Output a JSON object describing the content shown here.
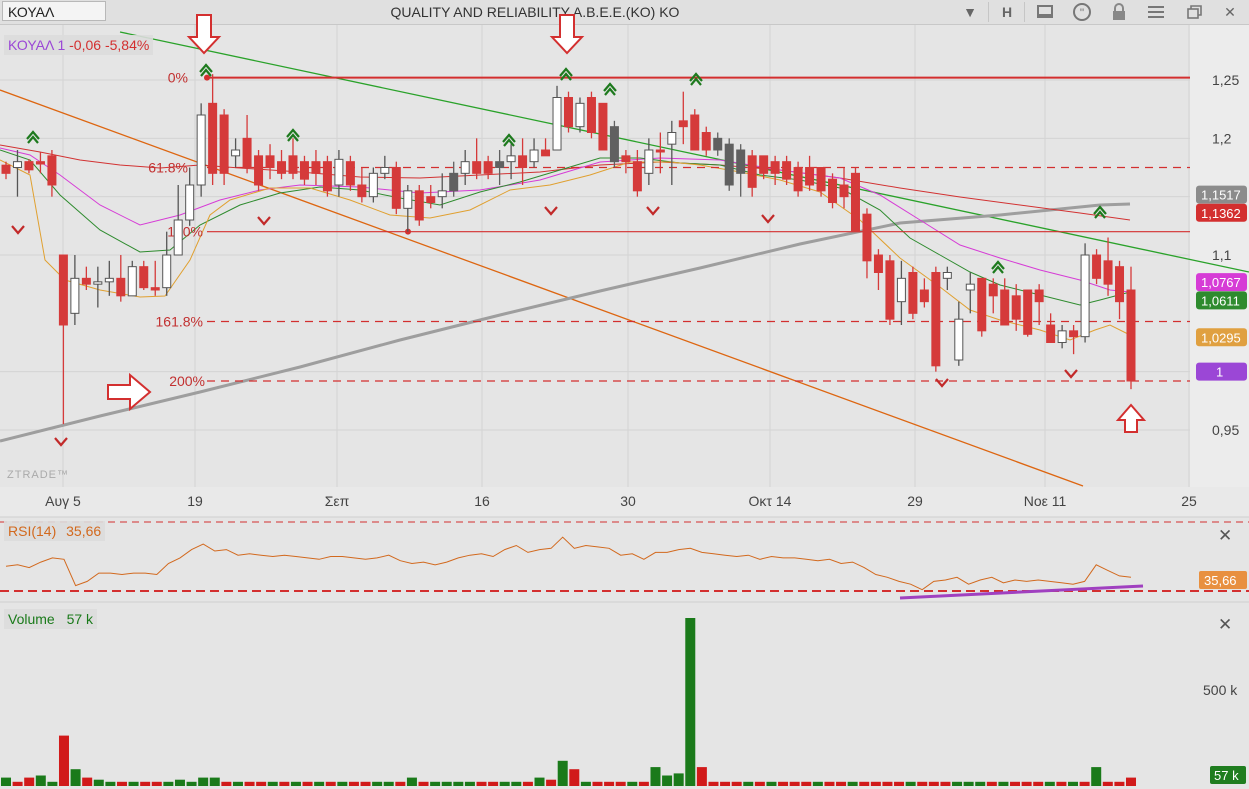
{
  "titlebar": {
    "symbol": "ΚΟΥΑΛ",
    "company": "QUALITY AND RELIABILITY A.B.E.E.(KO) KO",
    "h_label": "H"
  },
  "legend": {
    "price": {
      "name": "ΚΟΥΑΛ 1",
      "change": "-0,06",
      "pct": "-5,84%"
    },
    "rsi": {
      "name": "RSI(14)",
      "value": "35,66"
    },
    "volume": {
      "name": "Volume",
      "value": "57 k"
    }
  },
  "watermark": "ZTRADE™",
  "colors": {
    "up": "#ffffff",
    "down": "#d53a3a",
    "neutral": "#606060",
    "fib": "#d32f2f",
    "sma200": "#9a9a9a",
    "rsi": "#d2691e",
    "vol_up": "#1a7a1a",
    "vol_down": "#d11a1a"
  },
  "chart_data": [
    {
      "type": "candlestick",
      "title": "QUALITY AND RELIABILITY A.B.E.E.(KO) KO",
      "x_ticks": [
        "Αυγ 5",
        "19",
        "Σεπ",
        "16",
        "30",
        "Οκτ 14",
        "29",
        "Νοε 11",
        "25"
      ],
      "y_ticks": [
        "1,25",
        "1,2",
        "1,15",
        "1,1",
        "1",
        "0,95"
      ],
      "ylim": [
        0.91,
        1.27
      ],
      "candles": [
        [
          1.177,
          1.18,
          1.165,
          1.17
        ],
        [
          1.175,
          1.19,
          1.15,
          1.18
        ],
        [
          1.18,
          1.182,
          1.17,
          1.173
        ],
        [
          1.18,
          1.188,
          1.17,
          1.178
        ],
        [
          1.185,
          1.19,
          1.15,
          1.16
        ],
        [
          1.1,
          1.1,
          0.955,
          1.04
        ],
        [
          1.05,
          1.1,
          1.04,
          1.08
        ],
        [
          1.08,
          1.09,
          1.07,
          1.075
        ],
        [
          1.075,
          1.09,
          1.055,
          1.077
        ],
        [
          1.077,
          1.095,
          1.065,
          1.08
        ],
        [
          1.08,
          1.1,
          1.06,
          1.065
        ],
        [
          1.065,
          1.095,
          1.065,
          1.09
        ],
        [
          1.09,
          1.095,
          1.07,
          1.072
        ],
        [
          1.072,
          1.095,
          1.065,
          1.07
        ],
        [
          1.072,
          1.12,
          1.065,
          1.1
        ],
        [
          1.1,
          1.16,
          1.1,
          1.13
        ],
        [
          1.13,
          1.175,
          1.125,
          1.16
        ],
        [
          1.16,
          1.23,
          1.15,
          1.22
        ],
        [
          1.23,
          1.255,
          1.16,
          1.17
        ],
        [
          1.22,
          1.225,
          1.16,
          1.17
        ],
        [
          1.185,
          1.2,
          1.175,
          1.19
        ],
        [
          1.2,
          1.22,
          1.17,
          1.175
        ],
        [
          1.185,
          1.19,
          1.155,
          1.16
        ],
        [
          1.185,
          1.195,
          1.165,
          1.175
        ],
        [
          1.18,
          1.19,
          1.165,
          1.17
        ],
        [
          1.185,
          1.2,
          1.165,
          1.17
        ],
        [
          1.18,
          1.185,
          1.16,
          1.165
        ],
        [
          1.18,
          1.19,
          1.16,
          1.17
        ],
        [
          1.18,
          1.185,
          1.15,
          1.155
        ],
        [
          1.16,
          1.19,
          1.15,
          1.182
        ],
        [
          1.18,
          1.185,
          1.155,
          1.16
        ],
        [
          1.16,
          1.175,
          1.145,
          1.15
        ],
        [
          1.15,
          1.175,
          1.145,
          1.17
        ],
        [
          1.17,
          1.185,
          1.165,
          1.175
        ],
        [
          1.175,
          1.18,
          1.135,
          1.14
        ],
        [
          1.14,
          1.16,
          1.12,
          1.155
        ],
        [
          1.155,
          1.16,
          1.125,
          1.13
        ],
        [
          1.15,
          1.16,
          1.14,
          1.145
        ],
        [
          1.15,
          1.17,
          1.14,
          1.155
        ],
        [
          1.155,
          1.18,
          1.15,
          1.17
        ],
        [
          1.17,
          1.19,
          1.16,
          1.18
        ],
        [
          1.18,
          1.2,
          1.165,
          1.17
        ],
        [
          1.18,
          1.185,
          1.165,
          1.17
        ],
        [
          1.175,
          1.19,
          1.16,
          1.18
        ],
        [
          1.18,
          1.195,
          1.165,
          1.185
        ],
        [
          1.185,
          1.2,
          1.16,
          1.175
        ],
        [
          1.18,
          1.2,
          1.175,
          1.19
        ],
        [
          1.19,
          1.2,
          1.185,
          1.185
        ],
        [
          1.19,
          1.245,
          1.19,
          1.235
        ],
        [
          1.235,
          1.24,
          1.205,
          1.21
        ],
        [
          1.21,
          1.235,
          1.205,
          1.23
        ],
        [
          1.235,
          1.24,
          1.2,
          1.205
        ],
        [
          1.23,
          1.23,
          1.19,
          1.19
        ],
        [
          1.21,
          1.215,
          1.175,
          1.18
        ],
        [
          1.185,
          1.19,
          1.17,
          1.18
        ],
        [
          1.18,
          1.19,
          1.15,
          1.155
        ],
        [
          1.17,
          1.2,
          1.16,
          1.19
        ],
        [
          1.19,
          1.205,
          1.17,
          1.19
        ],
        [
          1.195,
          1.215,
          1.16,
          1.205
        ],
        [
          1.215,
          1.24,
          1.195,
          1.21
        ],
        [
          1.22,
          1.225,
          1.19,
          1.19
        ],
        [
          1.205,
          1.21,
          1.185,
          1.19
        ],
        [
          1.2,
          1.205,
          1.185,
          1.19
        ],
        [
          1.195,
          1.2,
          1.155,
          1.16
        ],
        [
          1.19,
          1.195,
          1.15,
          1.17
        ],
        [
          1.185,
          1.19,
          1.15,
          1.158
        ],
        [
          1.185,
          1.185,
          1.165,
          1.17
        ],
        [
          1.18,
          1.185,
          1.16,
          1.17
        ],
        [
          1.18,
          1.185,
          1.16,
          1.165
        ],
        [
          1.175,
          1.18,
          1.15,
          1.155
        ],
        [
          1.175,
          1.185,
          1.155,
          1.16
        ],
        [
          1.175,
          1.175,
          1.15,
          1.155
        ],
        [
          1.165,
          1.17,
          1.14,
          1.145
        ],
        [
          1.16,
          1.175,
          1.14,
          1.15
        ],
        [
          1.17,
          1.175,
          1.12,
          1.12
        ],
        [
          1.135,
          1.14,
          1.08,
          1.095
        ],
        [
          1.1,
          1.105,
          1.07,
          1.085
        ],
        [
          1.095,
          1.1,
          1.04,
          1.045
        ],
        [
          1.06,
          1.095,
          1.04,
          1.08
        ],
        [
          1.085,
          1.09,
          1.045,
          1.05
        ],
        [
          1.07,
          1.08,
          1.055,
          1.06
        ],
        [
          1.085,
          1.09,
          1.0,
          1.005
        ],
        [
          1.08,
          1.09,
          1.07,
          1.085
        ],
        [
          1.01,
          1.06,
          1.005,
          1.045
        ],
        [
          1.07,
          1.085,
          1.05,
          1.075
        ],
        [
          1.08,
          1.08,
          1.03,
          1.035
        ],
        [
          1.075,
          1.08,
          1.05,
          1.065
        ],
        [
          1.07,
          1.08,
          1.04,
          1.04
        ],
        [
          1.065,
          1.075,
          1.035,
          1.045
        ],
        [
          1.07,
          1.07,
          1.03,
          1.032
        ],
        [
          1.07,
          1.075,
          1.04,
          1.06
        ],
        [
          1.04,
          1.05,
          1.025,
          1.025
        ],
        [
          1.025,
          1.04,
          1.02,
          1.035
        ],
        [
          1.035,
          1.04,
          1.015,
          1.03
        ],
        [
          1.03,
          1.11,
          1.025,
          1.1
        ],
        [
          1.1,
          1.105,
          1.075,
          1.08
        ],
        [
          1.095,
          1.115,
          1.065,
          1.075
        ],
        [
          1.09,
          1.095,
          1.045,
          1.06
        ],
        [
          1.07,
          1.09,
          0.985,
          0.992
        ]
      ],
      "moving_averages": [
        {
          "color": "#c9c0b0",
          "values": []
        }
      ],
      "fib_levels": [
        {
          "label": "0%",
          "value": 1.252
        },
        {
          "label": "61.8%",
          "value": 1.175
        },
        {
          "label": "100%",
          "value": 1.12
        },
        {
          "label": "161.8%",
          "value": 1.043
        },
        {
          "label": "200%",
          "value": 0.992
        }
      ],
      "price_badges": [
        {
          "label": "1,1517",
          "value": 1.1517,
          "color": "#8c8c8c"
        },
        {
          "label": "1,1362",
          "value": 1.1362,
          "color": "#d32f2f"
        },
        {
          "label": "1,0767",
          "value": 1.0767,
          "color": "#d63cd6"
        },
        {
          "label": "1,0611",
          "value": 1.0611,
          "color": "#2e8b2e"
        },
        {
          "label": "1,0295",
          "value": 1.0295,
          "color": "#e0a040"
        },
        {
          "label": "1",
          "value": 1.0,
          "color": "#9b47d6"
        }
      ]
    },
    {
      "type": "line",
      "title": "RSI(14)",
      "series": [
        {
          "name": "RSI(14)",
          "values": [
            43,
            44,
            42,
            46,
            49,
            48,
            29,
            32,
            38,
            38,
            37,
            38,
            38,
            37,
            45,
            49,
            55,
            59,
            54,
            55,
            51,
            52,
            51,
            50,
            51,
            50,
            49,
            48,
            50,
            50,
            49,
            48,
            49,
            51,
            47,
            45,
            46,
            44,
            46,
            49,
            51,
            52,
            50,
            55,
            58,
            53,
            55,
            56,
            64,
            56,
            58,
            57,
            56,
            51,
            52,
            48,
            53,
            53,
            55,
            56,
            53,
            52,
            51,
            50,
            51,
            48,
            50,
            49,
            49,
            48,
            47,
            48,
            45,
            46,
            42,
            37,
            35,
            32,
            30,
            26,
            32,
            33,
            35,
            30,
            33,
            35,
            31,
            33,
            32,
            33,
            32,
            31,
            30,
            32,
            44,
            40,
            36,
            35
          ]
        }
      ],
      "ylim": [
        20,
        75
      ],
      "last_label": "35,66"
    },
    {
      "type": "bar",
      "title": "Volume",
      "y_ticks": [
        "500 k"
      ],
      "last_label": "57 k",
      "values": [
        20,
        10,
        20,
        25,
        10,
        120,
        40,
        20,
        15,
        10,
        10,
        10,
        10,
        10,
        10,
        15,
        10,
        20,
        20,
        10,
        10,
        10,
        10,
        10,
        10,
        10,
        10,
        10,
        10,
        10,
        10,
        10,
        10,
        10,
        10,
        20,
        10,
        10,
        10,
        10,
        10,
        10,
        10,
        10,
        10,
        10,
        20,
        15,
        60,
        40,
        10,
        10,
        10,
        10,
        10,
        10,
        45,
        25,
        30,
        400,
        45,
        10,
        10,
        10,
        10,
        10,
        10,
        10,
        10,
        10,
        10,
        10,
        10,
        10,
        10,
        10,
        10,
        10,
        10,
        10,
        10,
        10,
        10,
        10,
        10,
        10,
        10,
        10,
        10,
        10,
        10,
        10,
        10,
        10,
        45,
        10,
        10,
        20
      ],
      "up": [
        1,
        0,
        0,
        1,
        1,
        0,
        1,
        0,
        1,
        1,
        0,
        1,
        0,
        0,
        1,
        1,
        1,
        1,
        1,
        0,
        1,
        0,
        0,
        1,
        0,
        1,
        0,
        1,
        0,
        1,
        0,
        0,
        1,
        1,
        0,
        1,
        0,
        1,
        1,
        1,
        1,
        0,
        0,
        1,
        1,
        0,
        1,
        0,
        1,
        0,
        1,
        0,
        0,
        0,
        1,
        0,
        1,
        1,
        1,
        1,
        0,
        0,
        0,
        0,
        1,
        0,
        1,
        0,
        0,
        0,
        1,
        0,
        0,
        1,
        0,
        0,
        0,
        0,
        1,
        0,
        0,
        0,
        1,
        1,
        1,
        0,
        1,
        0,
        0,
        0,
        1,
        0,
        1,
        0,
        1,
        0,
        0,
        0
      ]
    }
  ]
}
